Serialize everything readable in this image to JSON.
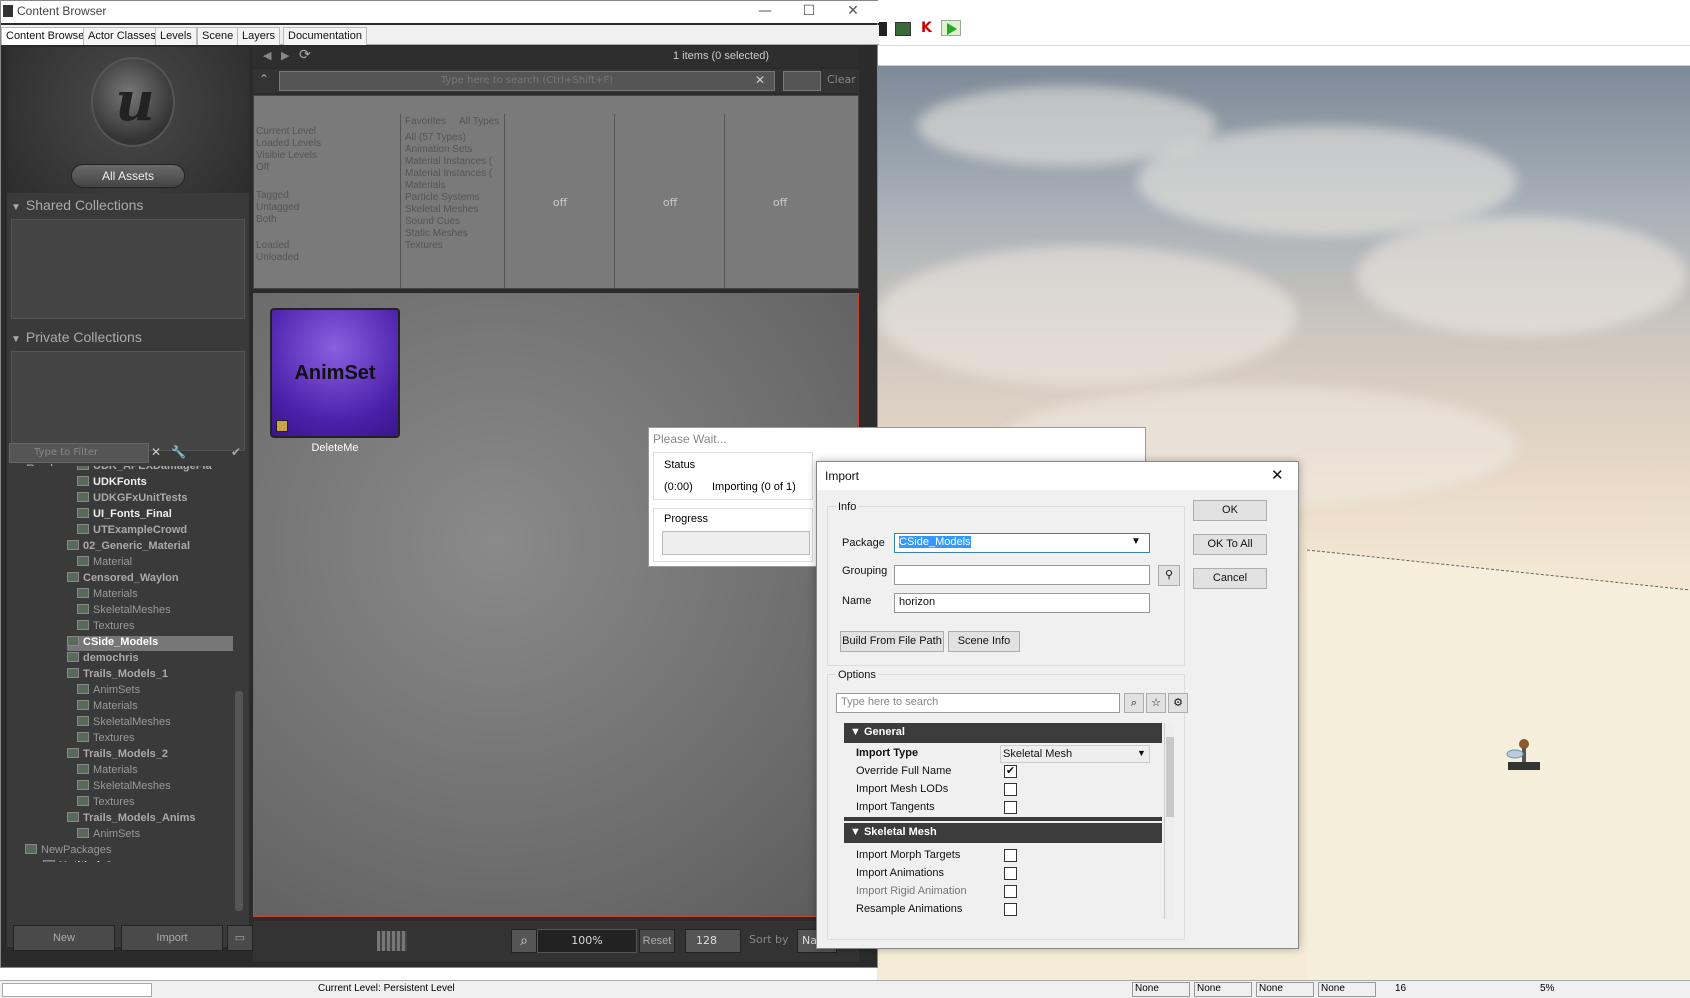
{
  "window": {
    "title": "Content Browser",
    "min_label": "—",
    "max_label": "☐",
    "close_label": "✕"
  },
  "tabs": [
    {
      "label": "Content Browser"
    },
    {
      "label": "Actor Classes"
    },
    {
      "label": "Levels"
    },
    {
      "label": "Scene"
    },
    {
      "label": "Layers"
    },
    {
      "label": "Documentation"
    }
  ],
  "left_panel": {
    "all_assets": "All Assets",
    "shared_collections": "Shared Collections",
    "private_collections": "Private Collections",
    "packages": "Packages",
    "filter_placeholder": "Type to Filter",
    "packages_list": [
      {
        "label": "UDK_APEXDamageFla",
        "style": "gold"
      },
      {
        "label": "UDKFonts",
        "style": "bold"
      },
      {
        "label": "UDKGFxUnitTests",
        "style": "gold"
      },
      {
        "label": "UI_Fonts_Final",
        "style": "bold"
      },
      {
        "label": "UTExampleCrowd",
        "style": "gold"
      },
      {
        "label": "02_Generic_Material",
        "style": "gold"
      },
      {
        "label": "Material",
        "style": "normal"
      },
      {
        "label": "Censored_Waylon",
        "style": "gold"
      },
      {
        "label": "Materials",
        "style": "normal"
      },
      {
        "label": "SkeletalMeshes",
        "style": "normal"
      },
      {
        "label": "Textures",
        "style": "normal"
      },
      {
        "label": "CSide_Models",
        "style": "sel"
      },
      {
        "label": "demochris",
        "style": "gold"
      },
      {
        "label": "Trails_Models_1",
        "style": "gold"
      },
      {
        "label": "AnimSets",
        "style": "normal"
      },
      {
        "label": "Materials",
        "style": "normal"
      },
      {
        "label": "SkeletalMeshes",
        "style": "normal"
      },
      {
        "label": "Textures",
        "style": "normal"
      },
      {
        "label": "Trails_Models_2",
        "style": "gold"
      },
      {
        "label": "Materials",
        "style": "normal"
      },
      {
        "label": "SkeletalMeshes",
        "style": "normal"
      },
      {
        "label": "Textures",
        "style": "normal"
      },
      {
        "label": "Trails_Models_Anims",
        "style": "gold"
      },
      {
        "label": "AnimSets",
        "style": "normal"
      },
      {
        "label": "NewPackages",
        "style": "normal"
      },
      {
        "label": "Untitled_2",
        "style": "bold"
      }
    ],
    "new_button": "New",
    "import_button": "Import"
  },
  "browser": {
    "items_count": "1 items (0 selected)",
    "search_placeholder": "Type here to search (Ctrl+Shift+F)",
    "clear_label": "Clear",
    "level_filters": [
      "Current Level",
      "Loaded Levels",
      "Visible Levels",
      "Off"
    ],
    "tag_filters": [
      "Tagged",
      "Untagged",
      "Both"
    ],
    "load_filters": [
      "Loaded",
      "Unloaded",
      "Both"
    ],
    "type_tabs": [
      "Favorites",
      "All Types"
    ],
    "type_filters": [
      "All (57 Types)",
      "Animation Sets",
      "Material Instances (",
      "Material Instances (",
      "Materials",
      "Particle Systems",
      "Skeletal Meshes",
      "Sound Cues",
      "Static Meshes",
      "Textures"
    ],
    "off_labels": [
      "off",
      "off",
      "off",
      "off"
    ],
    "asset_name": "DeleteMe",
    "asset_type": "AnimSet",
    "zoom": "100%",
    "reset_label": "Reset",
    "thumb_size": "128",
    "sort_label": "Sort by",
    "sort_value": "Nam"
  },
  "wait_dialog": {
    "title": "Please Wait...",
    "status_label": "Status",
    "time": "(0:00)",
    "status_text": "Importing (0 of 1)",
    "progress_label": "Progress"
  },
  "import_dialog": {
    "title": "Import",
    "info_label": "Info",
    "package_label": "Package",
    "package_value": "CSide_Models",
    "grouping_label": "Grouping",
    "grouping_value": "",
    "name_label": "Name",
    "name_value": "horizon",
    "build_from_path": "Build From File Path",
    "scene_info": "Scene Info",
    "ok": "OK",
    "ok_to_all": "OK To All",
    "cancel": "Cancel",
    "options_label": "Options",
    "search_placeholder": "Type here to search",
    "general_header": "General",
    "general_props": [
      {
        "name": "Import Type",
        "value": "Skeletal Mesh",
        "type": "dropdown"
      },
      {
        "name": "Override Full Name",
        "checked": "✔",
        "type": "check"
      },
      {
        "name": "Import Mesh LODs",
        "checked": "",
        "type": "check"
      },
      {
        "name": "Import Tangents",
        "checked": "",
        "type": "check"
      }
    ],
    "skeletal_header": "Skeletal Mesh",
    "skeletal_props": [
      {
        "name": "Import Morph Targets",
        "checked": ""
      },
      {
        "name": "Import Animations",
        "checked": ""
      },
      {
        "name": "Import Rigid Animation",
        "checked": ""
      },
      {
        "name": "Resample Animations",
        "checked": ""
      }
    ]
  },
  "statusbar": {
    "current_level": "Current Level: Persistent Level",
    "none_fields": [
      "None",
      "None",
      "None",
      "None"
    ],
    "grid": "16",
    "rotation": "5%"
  }
}
